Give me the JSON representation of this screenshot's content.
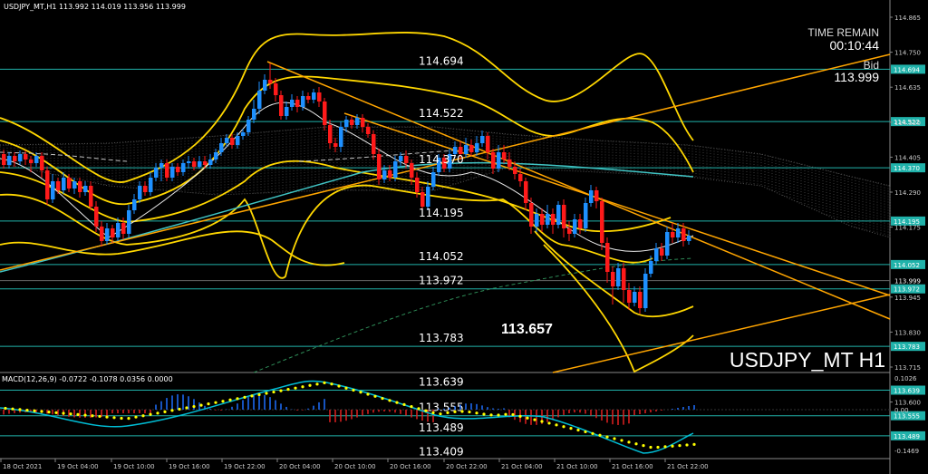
{
  "header": {
    "symbol_line": "USDJPY_MT,H1  113.992 114.019 113.956 113.999"
  },
  "info_panel": {
    "time_remain_label": "TIME REMAIN",
    "time_remain_value": "00:10:44",
    "bid_label": "Bid",
    "bid_value": "113.999"
  },
  "watermark": "USDJPY_MT H1",
  "highlight_label": "113.657",
  "levels": [
    {
      "label": "114.694",
      "axis_label": "114.694",
      "price": 114.694
    },
    {
      "label": "114.522",
      "axis_label": "114.522",
      "price": 114.522
    },
    {
      "label": "114.370",
      "axis_label": "114.370",
      "price": 114.37
    },
    {
      "label": "114.195",
      "axis_label": "114.195",
      "price": 114.195
    },
    {
      "label": "114.052",
      "axis_label": "114.052",
      "price": 114.052
    },
    {
      "label": "113.972",
      "axis_label": "113.972",
      "price": 113.972
    },
    {
      "label": "113.783",
      "axis_label": "113.783",
      "price": 113.783
    },
    {
      "label": "113.639",
      "axis_label": "113.639",
      "price": 113.639
    },
    {
      "label": "113.555",
      "axis_label": "113.555",
      "price": 113.555
    },
    {
      "label": "113.489",
      "axis_label": "113.489",
      "price": 113.489
    },
    {
      "label": "113.409",
      "axis_label": "",
      "price": 113.409
    }
  ],
  "price_axis_ticks": [
    "114.865",
    "114.750",
    "114.635",
    "114.520",
    "114.405",
    "114.290",
    "114.175",
    "113.945",
    "113.830",
    "113.715",
    "113.600"
  ],
  "bid_axis_label": "113.999",
  "macd": {
    "label": "MACD(12,26,9) -0.0722 -0.1078 0.0356 0.0000",
    "axis_ticks": [
      "0.1026",
      "0.00",
      "-0.1469"
    ]
  },
  "time_axis": [
    "18 Oct 2021",
    "19 Oct 04:00",
    "19 Oct 10:00",
    "19 Oct 16:00",
    "19 Oct 22:00",
    "20 Oct 04:00",
    "20 Oct 10:00",
    "20 Oct 16:00",
    "20 Oct 22:00",
    "21 Oct 04:00",
    "21 Oct 10:00",
    "21 Oct 16:00",
    "21 Oct 22:00"
  ],
  "colors": {
    "bull": "#1e90ff",
    "bear": "#ff1a1a",
    "level_line": "#20b2aa",
    "bands": "#ffd700",
    "trendline": "#ffa500",
    "ema": "#40c4c4",
    "axis_highlight": "#20b2aa"
  }
}
